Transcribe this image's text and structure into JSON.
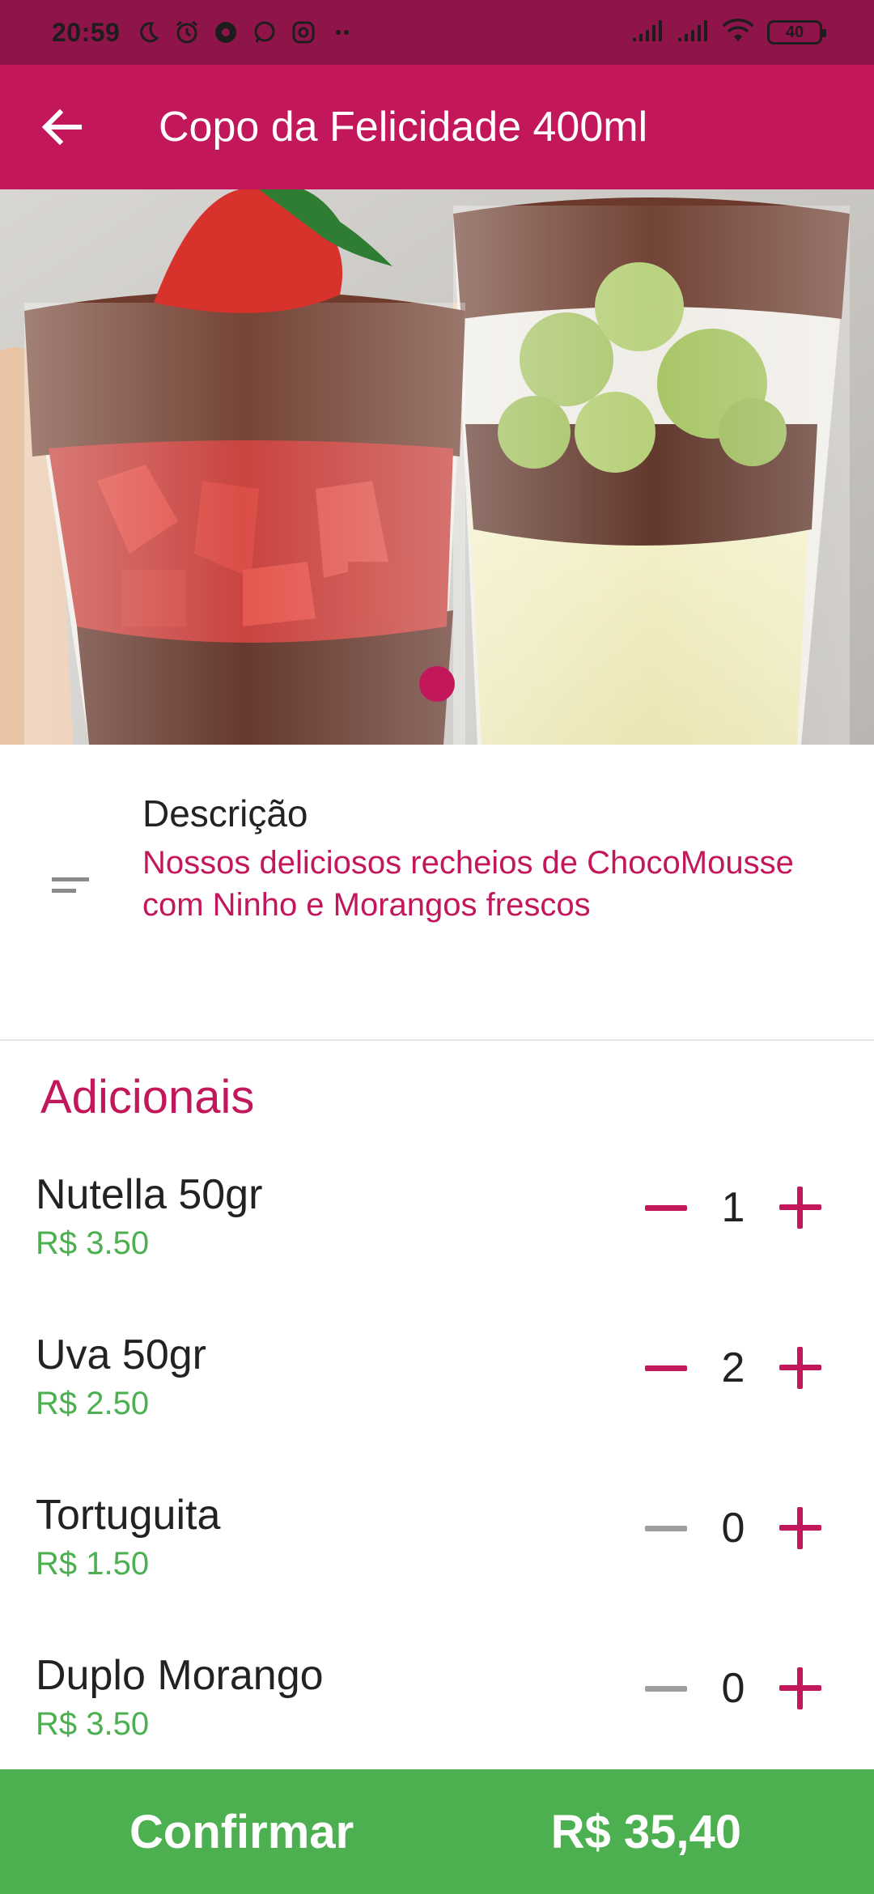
{
  "status_bar": {
    "time": "20:59",
    "left_icons": [
      "moon-icon",
      "alarm-icon",
      "chrome-icon",
      "whatsapp-icon",
      "instagram-icon",
      "more-dots-icon"
    ],
    "right_icons": [
      "signal-icon",
      "signal-icon",
      "wifi-icon"
    ],
    "battery": "40"
  },
  "app_bar": {
    "back_icon": "arrow-left-icon",
    "title": "Copo da Felicidade 400ml"
  },
  "hero": {
    "image": "product-photo",
    "indicator_color": "#c2185b"
  },
  "description": {
    "icon": "short-text-icon",
    "label": "Descrição",
    "text": "Nossos deliciosos recheios de ChocoMousse com Ninho e Morangos frescos"
  },
  "additionals": {
    "title": "Adicionais",
    "items": [
      {
        "name": "Nutella 50gr",
        "price": "R$ 3.50",
        "qty": "1",
        "minus_enabled": true
      },
      {
        "name": "Uva 50gr",
        "price": "R$ 2.50",
        "qty": "2",
        "minus_enabled": true
      },
      {
        "name": "Tortuguita",
        "price": "R$ 1.50",
        "qty": "0",
        "minus_enabled": false
      },
      {
        "name": "Duplo Morango",
        "price": "R$ 3.50",
        "qty": "0",
        "minus_enabled": false
      }
    ]
  },
  "footer": {
    "confirm_label": "Confirmar",
    "total": "R$ 35,40"
  },
  "colors": {
    "primary": "#c2185b",
    "primary_dark": "#8e144a",
    "accent_green": "#4caf50",
    "disabled_grey": "#9e9e9e"
  }
}
